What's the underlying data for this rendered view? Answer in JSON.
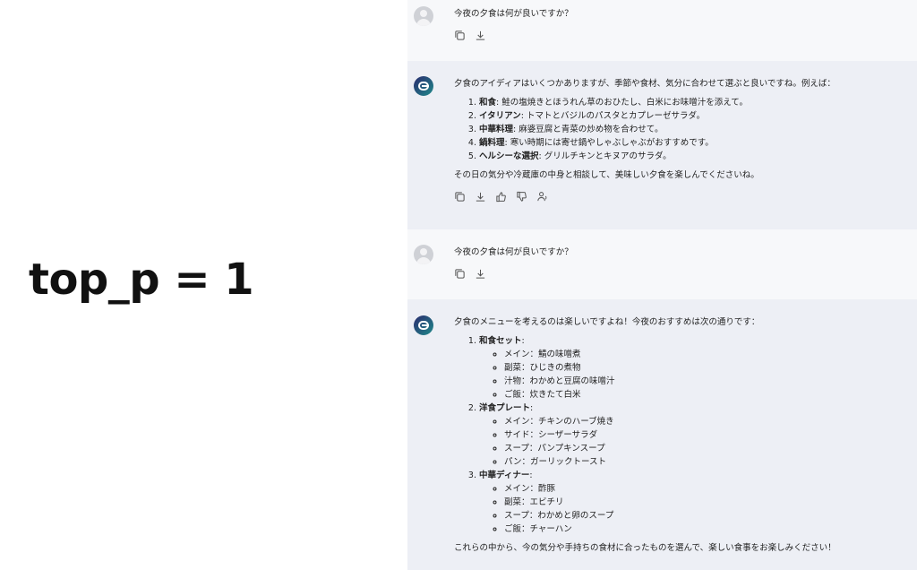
{
  "side_label": "top_p = 1",
  "turns": [
    {
      "role": "user",
      "text": "今夜の夕食は何が良いですか？"
    },
    {
      "role": "assistant",
      "intro": "夕食のアイディアはいくつかありますが、季節や食材、気分に合わせて選ぶと良いですね。例えば：",
      "items": [
        {
          "title": "和食",
          "text": ": 鮭の塩焼きとほうれん草のおひたし、白米にお味噌汁を添えて。"
        },
        {
          "title": "イタリアン",
          "text": ": トマトとバジルのパスタとカプレーゼサラダ。"
        },
        {
          "title": "中華料理",
          "text": ": 麻婆豆腐と青菜の炒め物を合わせて。"
        },
        {
          "title": "鍋料理",
          "text": ": 寒い時期には寄せ鍋やしゃぶしゃぶがおすすめです。"
        },
        {
          "title": "ヘルシーな選択",
          "text": ": グリルチキンとキヌアのサラダ。"
        }
      ],
      "outro": "その日の気分や冷蔵庫の中身と相談して、美味しい夕食を楽しんでくださいね。"
    },
    {
      "role": "user",
      "text": "今夜の夕食は何が良いですか？"
    },
    {
      "role": "assistant",
      "intro": "夕食のメニューを考えるのは楽しいですよね！今夜のおすすめは次の通りです：",
      "groups": [
        {
          "title": "和食セット",
          "sub": [
            "メイン：鯖の味噌煮",
            "副菜：ひじきの煮物",
            "汁物：わかめと豆腐の味噌汁",
            "ご飯：炊きたて白米"
          ]
        },
        {
          "title": "洋食プレート",
          "sub": [
            "メイン：チキンのハーブ焼き",
            "サイド：シーザーサラダ",
            "スープ：パンプキンスープ",
            "パン：ガーリックトースト"
          ]
        },
        {
          "title": "中華ディナー",
          "sub": [
            "メイン：酢豚",
            "副菜：エビチリ",
            "スープ：わかめと卵のスープ",
            "ご飯：チャーハン"
          ]
        }
      ],
      "outro": "これらの中から、今の気分や手持ちの食材に合ったものを選んで、楽しい食事をお楽しみください！"
    }
  ],
  "icons": {
    "user_actions": [
      "copy-icon",
      "download-icon"
    ],
    "assistant_actions": [
      "copy-icon",
      "download-icon",
      "thumbs-up-icon",
      "thumbs-down-icon",
      "voice-icon"
    ]
  },
  "colors": {
    "user_bg": "#f7f8fa",
    "assistant_bg": "#edeff5",
    "bot_avatar_start": "#2a2a6e",
    "bot_avatar_end": "#1f8a8a"
  }
}
